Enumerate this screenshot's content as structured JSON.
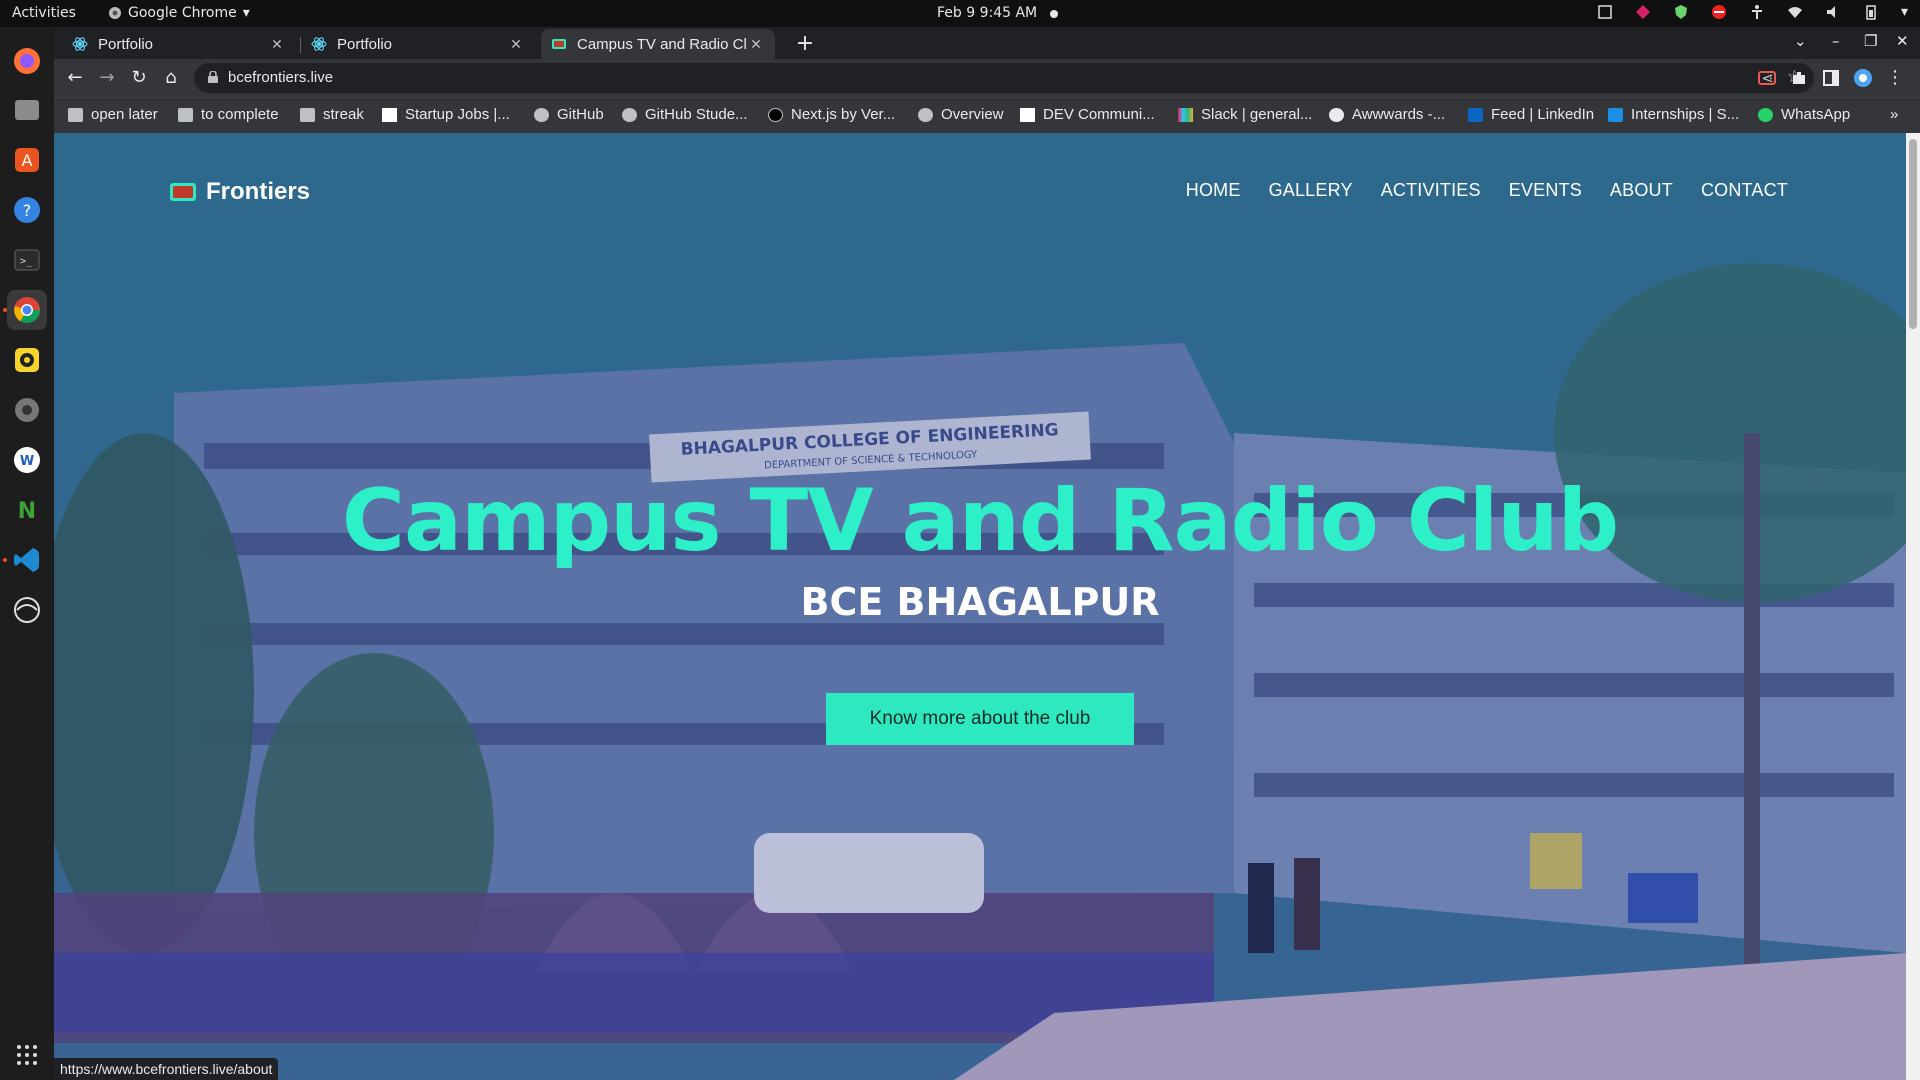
{
  "topbar": {
    "activities": "Activities",
    "app_name": "Google Chrome",
    "clock": "Feb 9  9:45 AM"
  },
  "dock": {
    "items": [
      "firefox-icon",
      "files-icon",
      "software-icon",
      "help-icon",
      "terminal-icon",
      "chrome-icon",
      "rhythmbox-icon",
      "settings-icon",
      "webstorm-icon",
      "nodejs-icon",
      "vscode-icon",
      "browser-icon"
    ],
    "apps_grid": "show-applications-icon"
  },
  "tabs": [
    {
      "title": "Portfolio"
    },
    {
      "title": "Portfolio"
    },
    {
      "title": "Campus TV and Radio Club"
    }
  ],
  "omnibox": {
    "url": "bcefrontiers.live"
  },
  "bookmarks": [
    {
      "label": "open later",
      "icon": "folder-icon"
    },
    {
      "label": "to complete",
      "icon": "folder-icon"
    },
    {
      "label": "streak",
      "icon": "folder-icon"
    },
    {
      "label": "Startup Jobs |...",
      "icon": "wellfound-icon"
    },
    {
      "label": "GitHub",
      "icon": "github-icon"
    },
    {
      "label": "GitHub Stude...",
      "icon": "github-icon"
    },
    {
      "label": "Next.js by Ver...",
      "icon": "nextjs-icon"
    },
    {
      "label": "Overview",
      "icon": "github-icon"
    },
    {
      "label": "DEV Communi...",
      "icon": "dev-icon"
    },
    {
      "label": "Slack | general...",
      "icon": "slack-icon"
    },
    {
      "label": "Awwwards -...",
      "icon": "awwwards-icon"
    },
    {
      "label": "Feed | LinkedIn",
      "icon": "linkedin-icon"
    },
    {
      "label": "Internships | S...",
      "icon": "internshala-icon"
    },
    {
      "label": "WhatsApp",
      "icon": "whatsapp-icon"
    }
  ],
  "site": {
    "brand": "Frontiers",
    "nav": [
      "HOME",
      "GALLERY",
      "ACTIVITIES",
      "EVENTS",
      "ABOUT",
      "CONTACT"
    ],
    "hero_title": "Campus TV and Radio Club",
    "hero_subtitle": "BCE BHAGALPUR",
    "cta_label": "Know more about the club",
    "building_sign": "BHAGALPUR COLLEGE OF ENGINEERING",
    "building_sign_sub": "DEPARTMENT OF SCIENCE & TECHNOLOGY"
  },
  "status_url": "https://www.bcefrontiers.live/about",
  "colors": {
    "accent": "#2ef0c8",
    "cta": "#2ee8bf",
    "chrome_bg": "#202124",
    "toolbar": "#35363a"
  }
}
